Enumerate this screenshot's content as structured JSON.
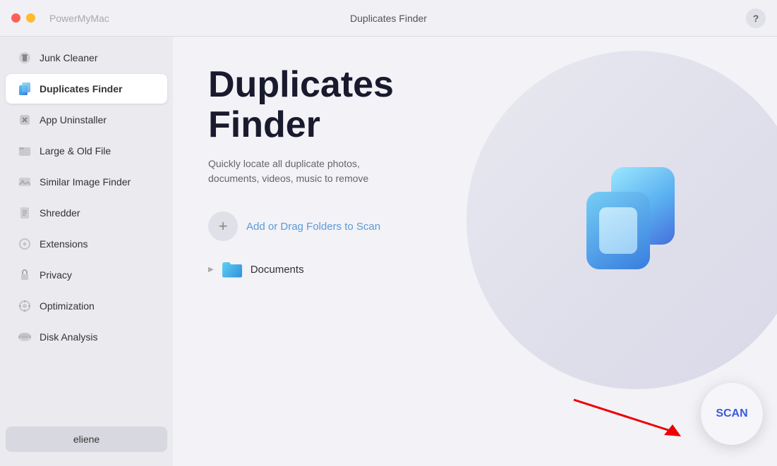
{
  "titlebar": {
    "app_name": "PowerMyMac",
    "center_title": "Duplicates Finder",
    "help_label": "?"
  },
  "sidebar": {
    "items": [
      {
        "id": "junk-cleaner",
        "label": "Junk Cleaner",
        "icon": "🧹"
      },
      {
        "id": "duplicates-finder",
        "label": "Duplicates Finder",
        "icon": "📋",
        "active": true
      },
      {
        "id": "app-uninstaller",
        "label": "App Uninstaller",
        "icon": "🗑"
      },
      {
        "id": "large-old-file",
        "label": "Large & Old File",
        "icon": "🗄"
      },
      {
        "id": "similar-image-finder",
        "label": "Similar Image Finder",
        "icon": "🖼"
      },
      {
        "id": "shredder",
        "label": "Shredder",
        "icon": "🔒"
      },
      {
        "id": "extensions",
        "label": "Extensions",
        "icon": "⚙"
      },
      {
        "id": "privacy",
        "label": "Privacy",
        "icon": "🔐"
      },
      {
        "id": "optimization",
        "label": "Optimization",
        "icon": "⚙"
      },
      {
        "id": "disk-analysis",
        "label": "Disk Analysis",
        "icon": "💾"
      }
    ],
    "user": {
      "label": "eliene"
    }
  },
  "main": {
    "title_line1": "Duplicates",
    "title_line2": "Finder",
    "description": "Quickly locate all duplicate photos, documents, videos, music to remove",
    "add_folder_label": "Add or Drag Folders to Scan",
    "folder_items": [
      {
        "name": "Documents"
      }
    ],
    "scan_label": "SCAN"
  }
}
